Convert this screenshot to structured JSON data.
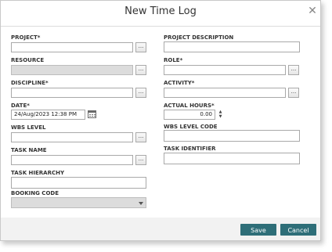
{
  "dialog": {
    "title": "New Time Log",
    "close_glyph": "✕"
  },
  "fields": {
    "project": {
      "label": "PROJECT*",
      "value": "",
      "picker": "..."
    },
    "resource": {
      "label": "RESOURCE",
      "value": "",
      "picker": "..."
    },
    "discipline": {
      "label": "DISCIPLINE*",
      "value": "",
      "picker": "..."
    },
    "date": {
      "label": "DATE*",
      "value": "24/Aug/2023 12:38 PM"
    },
    "wbs_level": {
      "label": "WBS LEVEL",
      "value": "",
      "picker": "..."
    },
    "task_name": {
      "label": "TASK NAME",
      "value": "",
      "picker": "..."
    },
    "task_hierarchy": {
      "label": "TASK HIERARCHY",
      "value": ""
    },
    "booking_code": {
      "label": "BOOKING CODE",
      "value": ""
    },
    "project_description": {
      "label": "PROJECT DESCRIPTION",
      "value": ""
    },
    "role": {
      "label": "ROLE*",
      "value": "",
      "picker": "..."
    },
    "activity": {
      "label": "ACTIVITY*",
      "value": "",
      "picker": "..."
    },
    "actual_hours": {
      "label": "ACTUAL HOURS*",
      "value": "0.00",
      "up": "▲",
      "down": "▼"
    },
    "wbs_level_code": {
      "label": "WBS LEVEL CODE",
      "value": ""
    },
    "task_identifier": {
      "label": "TASK IDENTIFIER",
      "value": ""
    }
  },
  "footer": {
    "save_label": "Save",
    "cancel_label": "Cancel"
  },
  "colors": {
    "button": "#2e6e78",
    "disabled_field": "#dcdcdc"
  }
}
